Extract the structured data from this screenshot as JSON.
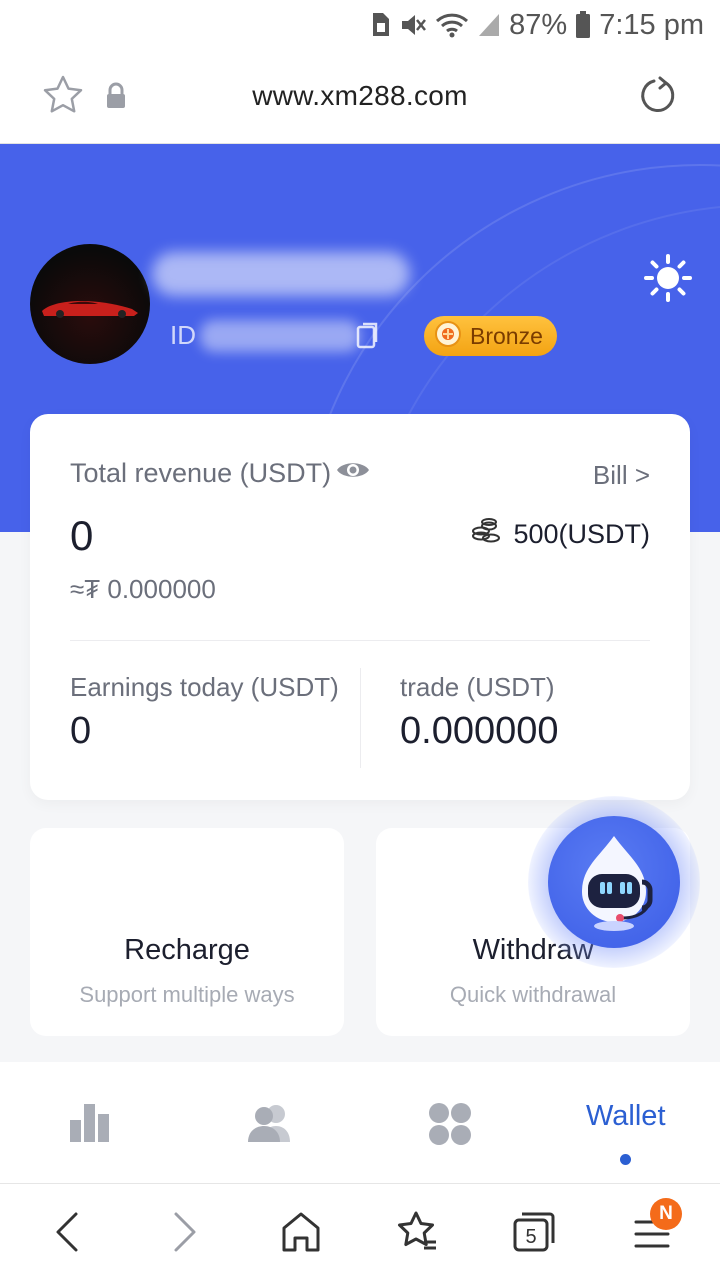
{
  "status_bar": {
    "battery": "87%",
    "time": "7:15 pm",
    "icons": [
      "sim-icon",
      "mute-icon",
      "wifi-icon",
      "signal-icon",
      "battery-icon"
    ]
  },
  "browser": {
    "url": "www.xm288.com",
    "icons": [
      "star-icon",
      "lock-icon",
      "reload-icon"
    ]
  },
  "profile": {
    "id_prefix": "ID",
    "level_badge": "Bronze",
    "icons": [
      "avatar",
      "copy-icon",
      "theme-sun-icon"
    ]
  },
  "revenue": {
    "total_label": "Total revenue (USDT)",
    "total_value": "0",
    "bill_link": "Bill >",
    "balance": "500(USDT)",
    "approx_value": "≈₮ 0.000000",
    "earnings_label": "Earnings today (USDT)",
    "earnings_value": "0",
    "trade_label": "trade (USDT)",
    "trade_value": "0.000000"
  },
  "actions": {
    "recharge_title": "Recharge",
    "recharge_sub": "Support multiple ways",
    "withdraw_title": "Withdraw",
    "withdraw_sub": "Quick withdrawal"
  },
  "app_nav": {
    "items": [
      "chart-icon",
      "users-icon",
      "apps-icon",
      "Wallet"
    ],
    "active": "Wallet"
  },
  "browser_bar": {
    "tabs_count": "5",
    "notification_badge": "N"
  },
  "colors": {
    "primary_blue": "#4762ea",
    "badge_gold": "#ffc23e",
    "wallet_blue": "#2b5fd2",
    "notif_orange": "#f46b1a"
  }
}
